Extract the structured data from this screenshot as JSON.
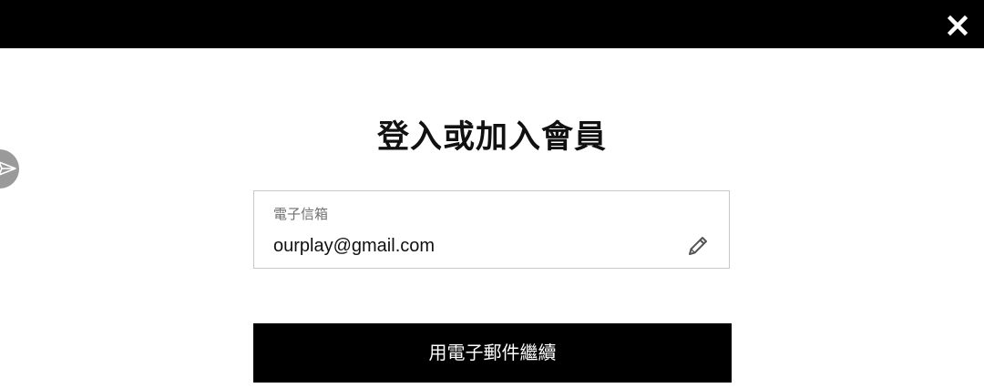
{
  "header": {
    "close_icon": "close-icon"
  },
  "floating": {
    "share_icon": "send-icon"
  },
  "main": {
    "title": "登入或加入會員",
    "email_field": {
      "label": "電子信箱",
      "value": "ourplay@gmail.com",
      "edit_icon": "pencil-icon"
    },
    "continue_label": "用電子郵件繼續"
  },
  "colors": {
    "background": "#ffffff",
    "topbar": "#000000",
    "button": "#000000",
    "button_text": "#ffffff",
    "field_border": "#c8c8c8",
    "label_text": "#707070",
    "floating_button": "#9a9a9a"
  }
}
